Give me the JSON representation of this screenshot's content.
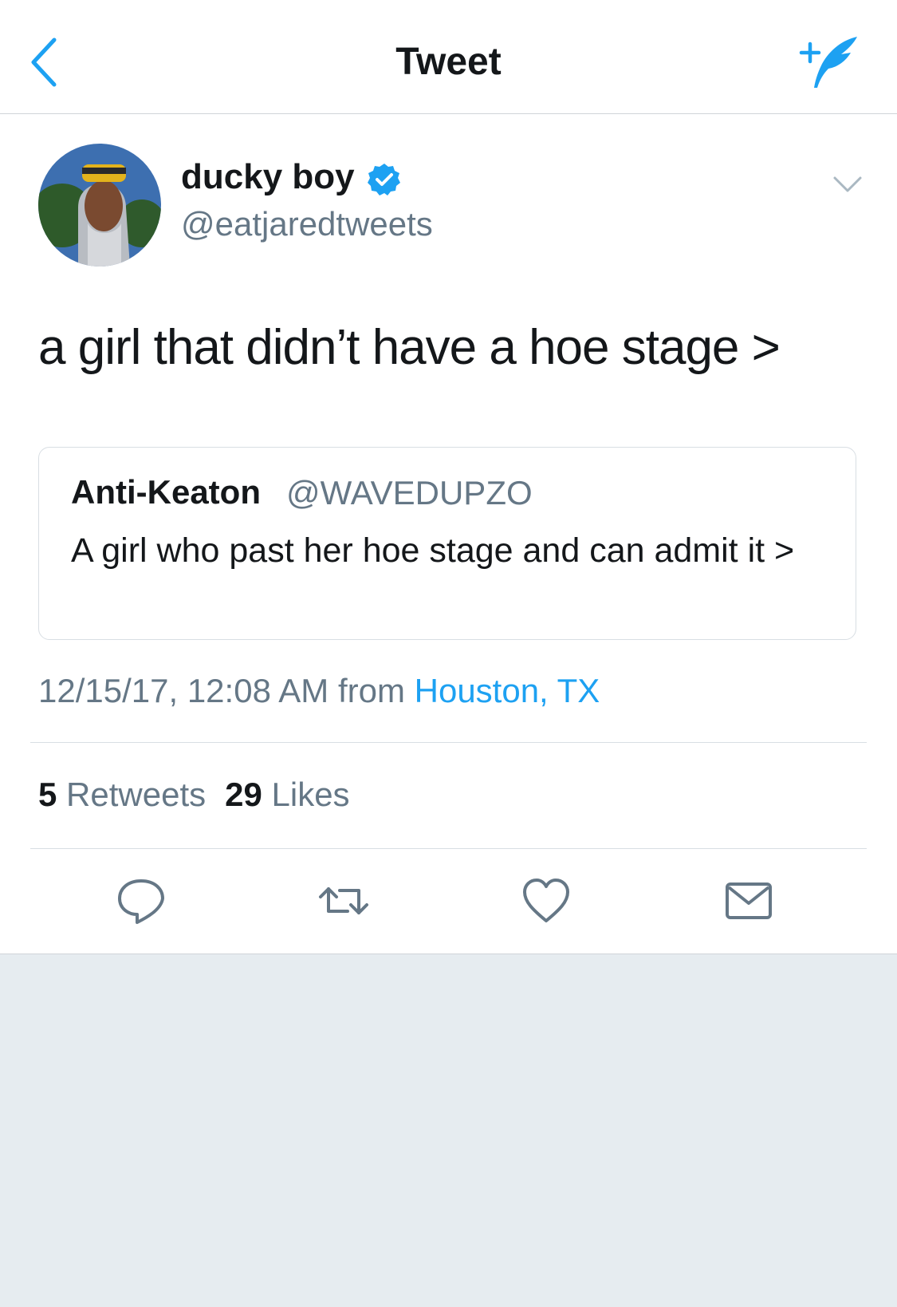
{
  "nav": {
    "title": "Tweet"
  },
  "author": {
    "name": "ducky boy",
    "handle": "@eatjaredtweets",
    "verified": true
  },
  "tweet": {
    "text": "a girl that didn’t have a hoe stage >"
  },
  "quoted": {
    "name": "Anti-Keaton",
    "handle": "@WAVEDUPZO",
    "text": "A girl who past her hoe stage and can admit it >"
  },
  "meta": {
    "timestamp": "12/15/17, 12:08 AM",
    "from_label": "from",
    "location": "Houston, TX"
  },
  "stats": {
    "retweets_count": "5",
    "retweets_label": "Retweets",
    "likes_count": "29",
    "likes_label": "Likes"
  },
  "icons": [
    "back-chevron-icon",
    "compose-tweet-icon",
    "verified-badge-icon",
    "caret-down-icon",
    "reply-icon",
    "retweet-icon",
    "like-icon",
    "direct-message-icon"
  ],
  "colors": {
    "accent": "#1da1f2",
    "secondary_text": "#657786",
    "primary_text": "#14171a",
    "background_below": "#e6ecf0"
  }
}
